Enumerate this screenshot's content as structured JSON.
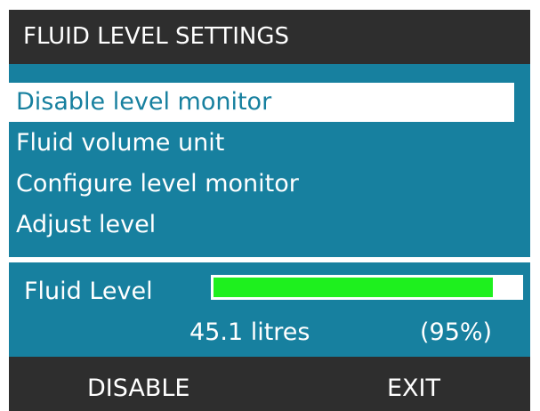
{
  "header": {
    "title": "FLUID LEVEL SETTINGS"
  },
  "menu": {
    "items": [
      {
        "label": "Disable level monitor",
        "selected": true
      },
      {
        "label": "Fluid volume unit",
        "selected": false
      },
      {
        "label": "Configure level monitor",
        "selected": false
      },
      {
        "label": "Adjust level",
        "selected": false
      }
    ]
  },
  "level": {
    "label": "Fluid Level",
    "volume_text": "45.1  litres",
    "percent_text": "(95%)",
    "fill_fraction": 0.91
  },
  "softkeys": {
    "left": "DISABLE",
    "right": "EXIT"
  },
  "colors": {
    "panel": "#17809f",
    "header": "#2e2e2e",
    "selection": "#ffffff",
    "level_fill": "#1ef01e"
  }
}
